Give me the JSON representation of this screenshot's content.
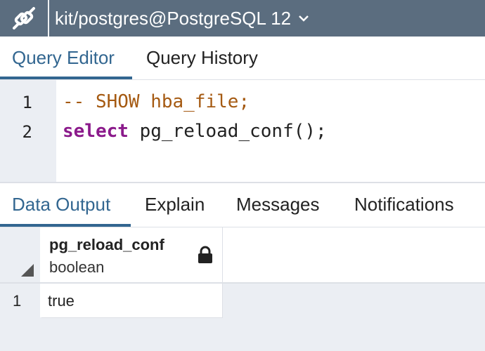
{
  "connection": {
    "title": "kit/postgres@PostgreSQL 12",
    "icon": "connection-plug-icon",
    "dropdown_icon": "chevron-down-icon"
  },
  "editor_tabs": [
    {
      "label": "Query Editor",
      "active": true
    },
    {
      "label": "Query History",
      "active": false
    }
  ],
  "editor": {
    "lines": [
      {
        "number": "1",
        "text": "-- SHOW hba_file;"
      },
      {
        "number": "2",
        "keyword": "select",
        "rest": " pg_reload_conf();"
      }
    ]
  },
  "output_tabs": [
    {
      "label": "Data Output",
      "active": true
    },
    {
      "label": "Explain",
      "active": false
    },
    {
      "label": "Messages",
      "active": false
    },
    {
      "label": "Notifications",
      "active": false
    }
  ],
  "grid": {
    "columns": [
      {
        "name": "pg_reload_conf",
        "type": "boolean",
        "icon": "lock-icon"
      }
    ],
    "rows": [
      {
        "number": "1",
        "values": [
          "true"
        ]
      }
    ]
  },
  "colors": {
    "topbar": "#5b6d7f",
    "accent": "#326690",
    "comment": "#a55a12",
    "keyword": "#8b1a8b"
  }
}
